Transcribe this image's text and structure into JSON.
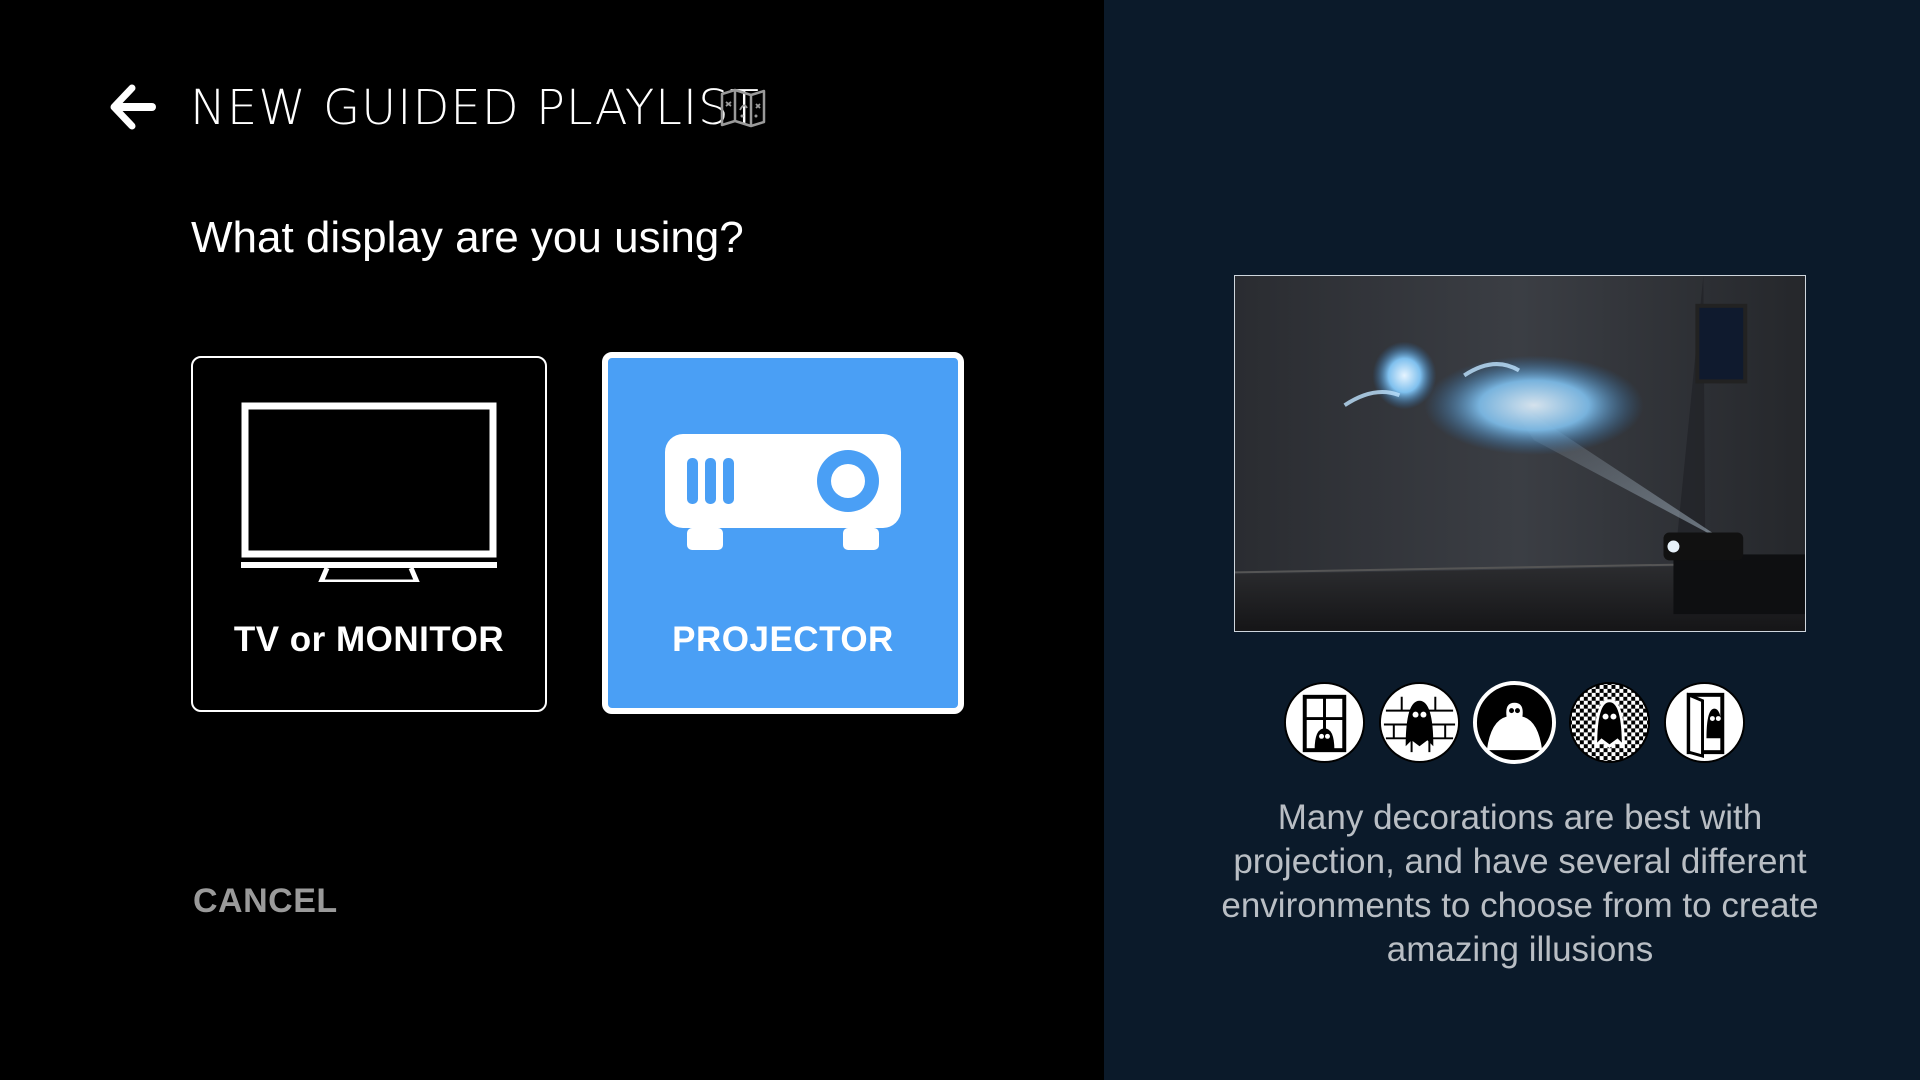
{
  "header": {
    "title": "NEW GUIDED PLAYLIST",
    "back_icon": "arrow-left-icon",
    "guide_icon": "map-icon"
  },
  "question": "What display are you using?",
  "options": [
    {
      "label": "TV or MONITOR",
      "icon": "tv-icon",
      "selected": false
    },
    {
      "label": "PROJECTOR",
      "icon": "projector-icon",
      "selected": true
    }
  ],
  "cancel_label": "CANCEL",
  "side_panel": {
    "preview_image": "projected-ghost-preview",
    "environment_icons": [
      "window-ghost-icon",
      "brick-wall-ghost-icon",
      "ghost-silhouette-icon",
      "checker-ghost-icon",
      "door-ghost-icon"
    ],
    "description": "Many decorations are best with projection, and have several different environments to choose from to create amazing illusions"
  },
  "colors": {
    "selected_accent": "#4a9ff5",
    "left_background": "#000000",
    "right_background": "#0b1a2a",
    "muted_text": "#9a9a9a"
  }
}
